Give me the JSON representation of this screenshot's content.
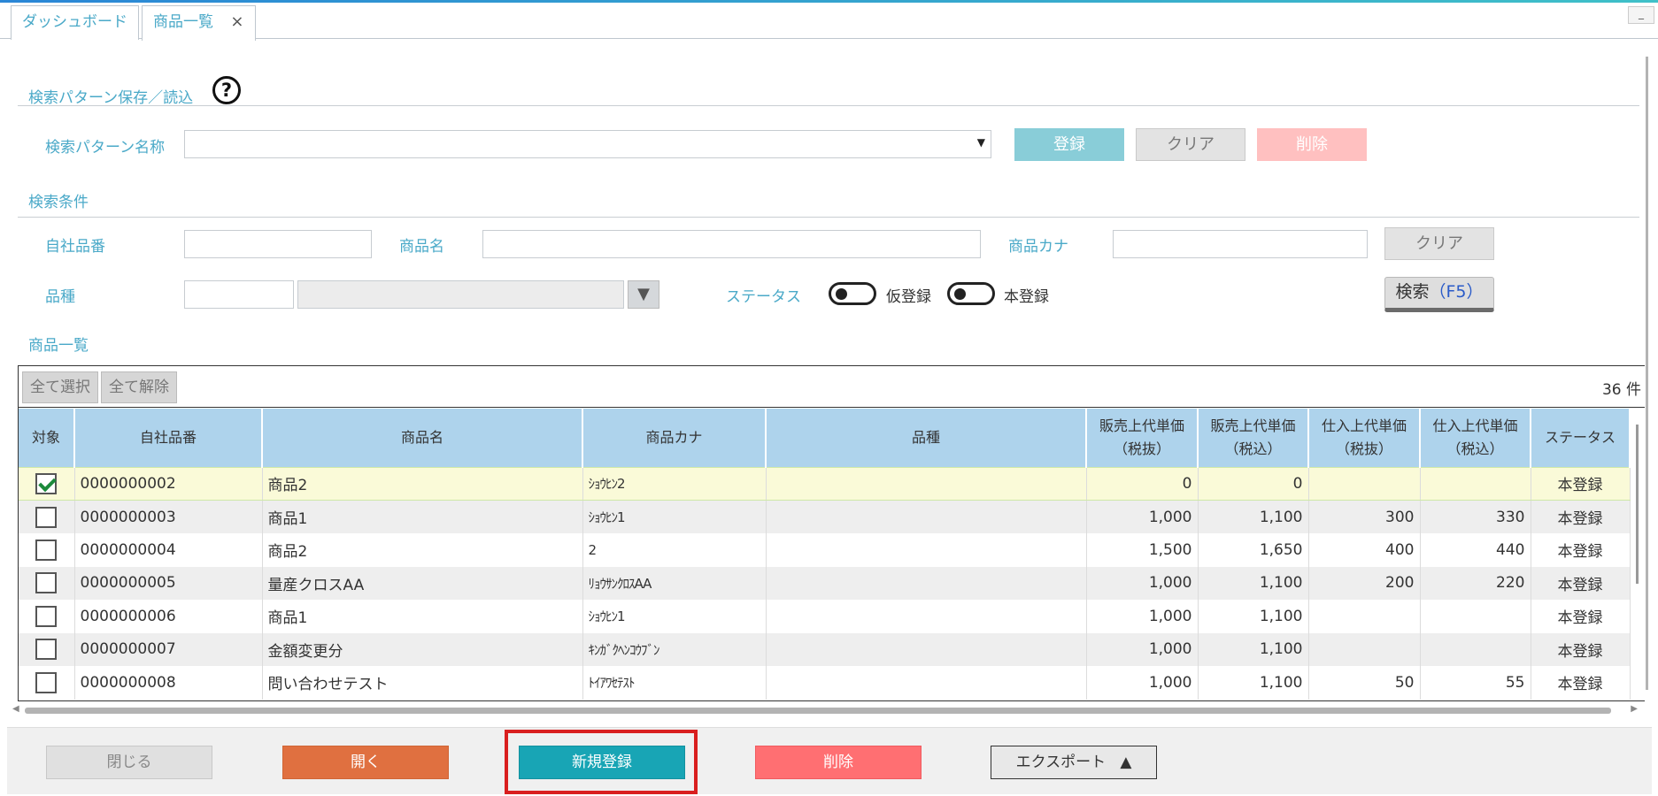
{
  "tabs": [
    {
      "label": "ダッシュボード"
    },
    {
      "label": "商品一覧",
      "close": "×"
    }
  ],
  "window": {
    "minimize": "_"
  },
  "pattern": {
    "section_title": "検索パターン保存／読込",
    "help": "?",
    "name_label": "検索パターン名称",
    "select_value": "",
    "register": "登録",
    "clear": "クリア",
    "delete": "削除"
  },
  "conditions": {
    "section_title": "検索条件",
    "product_code_label": "自社品番",
    "product_code_value": "",
    "product_name_label": "商品名",
    "product_name_value": "",
    "product_kana_label": "商品カナ",
    "product_kana_value": "",
    "clear": "クリア",
    "category_label": "品種",
    "category_code": "",
    "category_name": "",
    "category_dropdown": "▼",
    "status_label": "ステータス",
    "status_temp": "仮登録",
    "status_main": "本登録",
    "search_label": "検索",
    "search_key": "（F5）"
  },
  "list": {
    "section_title": "商品一覧",
    "select_all": "全て選択",
    "deselect_all": "全て解除",
    "count": "36 件",
    "headers": {
      "target": "対象",
      "code": "自社品番",
      "name": "商品名",
      "kana": "商品カナ",
      "category": "品種",
      "sale_ex_1": "販売上代単価",
      "sale_ex_2": "（税抜）",
      "sale_in_1": "販売上代単価",
      "sale_in_2": "（税込）",
      "buy_ex_1": "仕入上代単価",
      "buy_ex_2": "（税抜）",
      "buy_in_1": "仕入上代単価",
      "buy_in_2": "（税込）",
      "status": "ステータス"
    },
    "rows": [
      {
        "checked": true,
        "code": "0000000002",
        "name": "商品2",
        "kana": "ｼｮｳﾋﾝ2",
        "category": "",
        "sale_ex": "0",
        "sale_in": "0",
        "buy_ex": "",
        "buy_in": "",
        "status": "本登録"
      },
      {
        "checked": false,
        "code": "0000000003",
        "name": "商品1",
        "kana": "ｼｮｳﾋﾝ1",
        "category": "",
        "sale_ex": "1,000",
        "sale_in": "1,100",
        "buy_ex": "300",
        "buy_in": "330",
        "status": "本登録"
      },
      {
        "checked": false,
        "code": "0000000004",
        "name": "商品2",
        "kana": "2",
        "category": "",
        "sale_ex": "1,500",
        "sale_in": "1,650",
        "buy_ex": "400",
        "buy_in": "440",
        "status": "本登録"
      },
      {
        "checked": false,
        "code": "0000000005",
        "name": "量産クロスAA",
        "kana": "ﾘｮｳｻﾝｸﾛｽAA",
        "category": "",
        "sale_ex": "1,000",
        "sale_in": "1,100",
        "buy_ex": "200",
        "buy_in": "220",
        "status": "本登録"
      },
      {
        "checked": false,
        "code": "0000000006",
        "name": "商品1",
        "kana": "ｼｮｳﾋﾝ1",
        "category": "",
        "sale_ex": "1,000",
        "sale_in": "1,100",
        "buy_ex": "",
        "buy_in": "",
        "status": "本登録"
      },
      {
        "checked": false,
        "code": "0000000007",
        "name": "金額変更分",
        "kana": "ｷﾝｶﾞｸﾍﾝｺｳﾌﾞﾝ",
        "category": "",
        "sale_ex": "1,000",
        "sale_in": "1,100",
        "buy_ex": "",
        "buy_in": "",
        "status": "本登録"
      },
      {
        "checked": false,
        "code": "0000000008",
        "name": "問い合わせテスト",
        "kana": "ﾄｲｱﾜｾﾃｽﾄ",
        "category": "",
        "sale_ex": "1,000",
        "sale_in": "1,100",
        "buy_ex": "50",
        "buy_in": "55",
        "status": "本登録"
      }
    ]
  },
  "footer": {
    "close": "閉じる",
    "open": "開く",
    "new": "新規登録",
    "delete": "削除",
    "export": "エクスポート",
    "export_icon": "▲"
  },
  "colors": {
    "accent": "#4aa9c8",
    "header_bg": "#aed3ec",
    "new_button": "#18a5b5",
    "open_button": "#e07040",
    "delete_button": "#ff6f72",
    "highlight": "#d91f1f"
  }
}
